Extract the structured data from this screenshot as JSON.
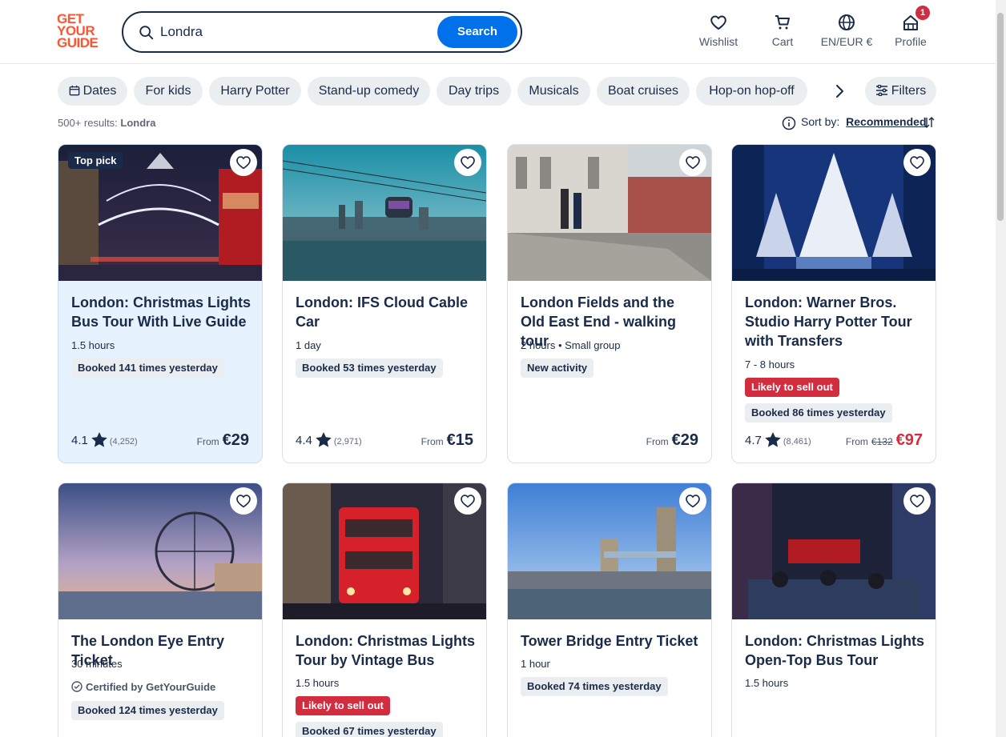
{
  "brand": {
    "line1": "GET",
    "line2": "YOUR",
    "line3": "GUIDE",
    "color": "#ff5533"
  },
  "search": {
    "value": "Londra",
    "button": "Search"
  },
  "nav": {
    "wishlist": "Wishlist",
    "cart": "Cart",
    "language": "EN/EUR €",
    "profile": "Profile",
    "profile_badge": "1"
  },
  "chips": [
    "Dates",
    "For kids",
    "Harry Potter",
    "Stand-up comedy",
    "Day trips",
    "Musicals",
    "Boat cruises",
    "Hop-on hop-off"
  ],
  "filters": "Filters",
  "results": {
    "count": "500+ results:",
    "query": "Londra"
  },
  "sort": {
    "label": "Sort by:",
    "value": "Recommended"
  },
  "cards": [
    {
      "title": "London: Christmas Lights Bus Tour With Live Guide",
      "badge": "Top pick",
      "duration": "1.5 hours",
      "booked": "Booked 141 times yesterday",
      "rating": "4.1",
      "reviews": "(4,252)",
      "from": "From",
      "price": "€29"
    },
    {
      "title": "London: IFS Cloud Cable Car",
      "duration": "1 day",
      "booked": "Booked 53 times yesterday",
      "rating": "4.4",
      "reviews": "(2,971)",
      "from": "From",
      "price": "€15"
    },
    {
      "title": "London Fields and the Old East End - walking tour",
      "duration": "2 hours • Small group",
      "booked": "New activity",
      "from": "From",
      "price": "€29"
    },
    {
      "title": "London: Warner Bros. Studio Harry Potter Tour with Transfers",
      "duration": "7 - 8 hours",
      "alert": "Likely to sell out",
      "booked": "Booked 86 times yesterday",
      "rating": "4.7",
      "reviews": "(8,461)",
      "from": "From",
      "old_price": "€132",
      "price": "€97"
    },
    {
      "title": "The London Eye Entry Ticket",
      "duration": "30 minutes",
      "certified": "Certified by GetYourGuide",
      "booked": "Booked 124 times yesterday"
    },
    {
      "title": "London: Christmas Lights Tour by Vintage Bus",
      "duration": "1.5 hours",
      "alert": "Likely to sell out",
      "booked": "Booked 67 times yesterday"
    },
    {
      "title": "Tower Bridge Entry Ticket",
      "duration": "1 hour",
      "booked": "Booked 74 times yesterday"
    },
    {
      "title": "London: Christmas Lights Open-Top Bus Tour",
      "duration": "1.5 hours"
    }
  ],
  "colors": {
    "accent": "#0071eb",
    "dark": "#1a2b49",
    "alert": "#d22d3f",
    "top_card_bg": "#e6f2fd"
  }
}
